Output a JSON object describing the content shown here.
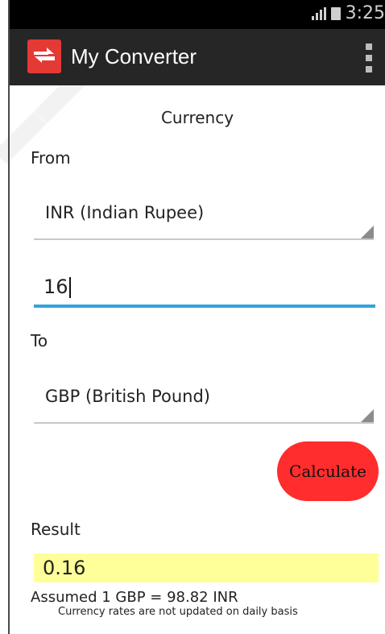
{
  "status_bar": {
    "time": "3:25"
  },
  "action_bar": {
    "title": "My Converter",
    "app_icon": "swap-arrows-icon",
    "menu_icon": "overflow-menu-icon",
    "app_icon_color": "#e53935"
  },
  "converter": {
    "section_title": "Currency",
    "from_label": "From",
    "from_currency": "INR (Indian Rupee)",
    "amount": "16",
    "to_label": "To",
    "to_currency": "GBP (British Pound)",
    "calculate_label": "Calculate",
    "calculate_color": "#ff2d2d",
    "input_accent_color": "#33a3d8"
  },
  "result": {
    "label": "Result",
    "value": "0.16",
    "highlight_color": "#ffff99",
    "assumed_rate": "Assumed 1 GBP = 98.82 INR",
    "note": "Currency rates are not updated on daily basis"
  }
}
